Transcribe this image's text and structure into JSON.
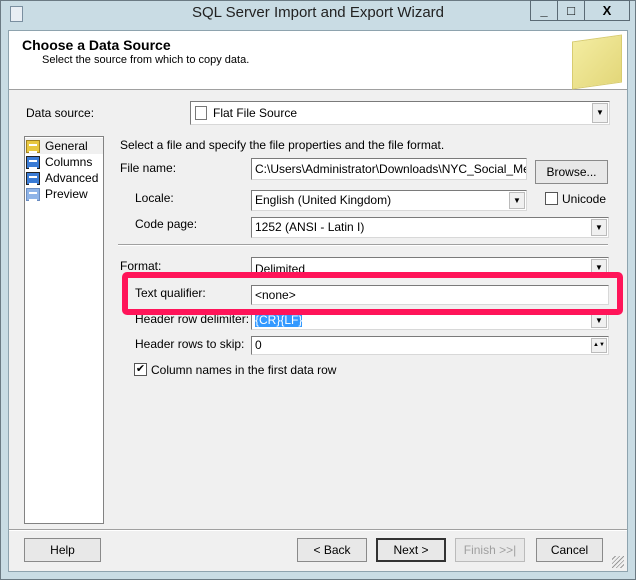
{
  "window": {
    "title": "SQL Server Import and Export Wizard",
    "minimize": "_",
    "maximize": "□",
    "close": "X"
  },
  "header": {
    "title": "Choose a Data Source",
    "subtitle": "Select the source from which to copy data."
  },
  "data_source": {
    "label": "Data source:",
    "value": "Flat File Source"
  },
  "nav": [
    {
      "label": "General"
    },
    {
      "label": "Columns"
    },
    {
      "label": "Advanced"
    },
    {
      "label": "Preview"
    }
  ],
  "general": {
    "instruction": "Select a file and specify the file properties and the file format.",
    "file_name_label": "File name:",
    "file_name": "C:\\Users\\Administrator\\Downloads\\NYC_Social_Media_Usage.csv",
    "browse": "Browse...",
    "locale_label": "Locale:",
    "locale": "English (United Kingdom)",
    "unicode_label": "Unicode",
    "code_page_label": "Code page:",
    "code_page": "1252  (ANSI - Latin I)",
    "format_label": "Format:",
    "format": "Delimited",
    "text_qualifier_label": "Text qualifier:",
    "text_qualifier": "<none>",
    "header_row_delimiter_label": "Header row delimiter:",
    "header_row_delimiter": "{CR}{LF}",
    "header_rows_skip_label": "Header rows to skip:",
    "header_rows_skip": "0",
    "column_names_label": "Column names in the first data row"
  },
  "buttons": {
    "help": "Help",
    "back": "< Back",
    "next": "Next >",
    "finish": "Finish >>|",
    "cancel": "Cancel"
  },
  "colors": {
    "highlight": "#ff1459",
    "selection": "#3399ff"
  }
}
